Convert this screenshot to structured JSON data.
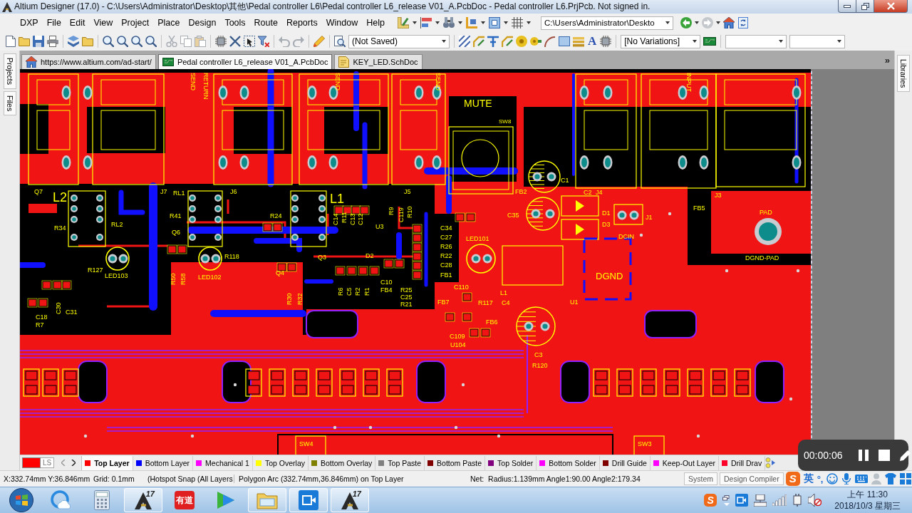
{
  "window": {
    "title": "Altium Designer (17.0) - C:\\Users\\Administrator\\Desktop\\其他\\Pedal controller L6\\Pedal controller L6_release V01_A.PcbDoc - Pedal controller L6.PrjPcb. Not signed in."
  },
  "menu": [
    "DXP",
    "File",
    "Edit",
    "View",
    "Project",
    "Place",
    "Design",
    "Tools",
    "Route",
    "Reports",
    "Window",
    "Help"
  ],
  "toolbar_1": {
    "path": "C:\\Users\\Administrator\\Deskto",
    "navigation": {
      "back": {
        "disabled": false
      },
      "forward": {
        "disabled": true
      }
    }
  },
  "toolbar_2": {
    "edit": {
      "cut": {
        "disabled": true
      },
      "copy": {
        "disabled": true
      },
      "paste": {
        "disabled": true
      },
      "undo": {
        "disabled": true
      },
      "redo": {
        "disabled": true
      }
    },
    "configuration": "(Not Saved)",
    "text_tool": "A",
    "variations": "[No Variations]"
  },
  "document_tabs": [
    {
      "kind": "home",
      "label": "https://www.altium.com/ad-start/",
      "selected": false
    },
    {
      "kind": "pcb",
      "label": "Pedal controller L6_release V01_A.PcbDoc",
      "selected": true
    },
    {
      "kind": "schematic",
      "label": "KEY_LED.SchDoc",
      "selected": false
    }
  ],
  "document_tabs_overflow": "»",
  "left_panel": [
    {
      "label": "Projects"
    },
    {
      "label": "Files"
    }
  ],
  "right_panel": [
    {
      "label": "Libraries"
    }
  ],
  "pcb": {
    "silkscreen": [
      "SEND",
      "RETURN",
      "SEND",
      "SEND",
      "INPUT",
      "MUTE",
      "SW8",
      "C1",
      "Q7",
      "L2",
      "J7",
      "RL1",
      "J6",
      "L1",
      "J5",
      "FB2",
      "C2",
      "J4",
      "J3",
      "R41",
      "R24",
      "C14",
      "R11",
      "C13",
      "C12",
      "R9",
      "C119",
      "R10",
      "C35",
      "D1",
      "J1",
      "FB5",
      "PAD",
      "R34",
      "RL2",
      "U3",
      "C34",
      "D3",
      "Q6",
      "C27",
      "LED101",
      "DCIN",
      "R26",
      "R118",
      "Q3",
      "D2",
      "R22",
      "DGND-PAD",
      "R127",
      "C28",
      "LED103",
      "R50",
      "R58",
      "LED102",
      "Q4",
      "FB1",
      "DGND",
      "C10",
      "C110",
      "R6",
      "C5",
      "R2",
      "R1",
      "FB4",
      "R25",
      "R30",
      "R32",
      "C25",
      "L1",
      "C30",
      "R21",
      "FB7",
      "R117",
      "C4",
      "U1",
      "C31",
      "C18",
      "FB6",
      "R7",
      "C109",
      "U104",
      "C3",
      "R120",
      "SW4",
      "SW3"
    ]
  },
  "layer_bar": {
    "current_layer": {
      "color": "#ff0000",
      "label": "LS"
    },
    "layers": [
      {
        "label": "Top Layer",
        "color": "#ff0000",
        "selected": true
      },
      {
        "label": "Bottom Layer",
        "color": "#0000ff",
        "selected": false
      },
      {
        "label": "Mechanical 1",
        "color": "#ff00ff",
        "selected": false
      },
      {
        "label": "Top Overlay",
        "color": "#ffff00",
        "selected": false
      },
      {
        "label": "Bottom Overlay",
        "color": "#808000",
        "selected": false
      },
      {
        "label": "Top Paste",
        "color": "#808080",
        "selected": false
      },
      {
        "label": "Bottom Paste",
        "color": "#800000",
        "selected": false
      },
      {
        "label": "Top Solder",
        "color": "#800080",
        "selected": false
      },
      {
        "label": "Bottom Solder",
        "color": "#ff00ff",
        "selected": false
      },
      {
        "label": "Drill Guide",
        "color": "#800000",
        "selected": false
      },
      {
        "label": "Keep-Out Layer",
        "color": "#ff00ff",
        "selected": false
      },
      {
        "label": "Drill Drav",
        "color": "#ff002a",
        "selected": false
      }
    ]
  },
  "recorder": {
    "time": "00:00:06"
  },
  "status_bar": {
    "cursor": "X:332.74mm Y:36.846mm",
    "grid": "Grid: 0.1mm",
    "snap": "(Hotspot Snap (All Layers",
    "selection": "Polygon Arc (332.74mm,36.846mm) on Top Layer",
    "net": "Net:  Radius:1.139mm Angle1:90.00 Angle2:179.34",
    "panels": [
      "System",
      "Design Compiler"
    ]
  },
  "ime_bar": {
    "logo": "S",
    "mode": "英",
    "punct": "°,",
    "tools": [
      {
        "kind": "smiley",
        "disabled": false
      },
      {
        "kind": "microphone",
        "disabled": false
      },
      {
        "kind": "keyboard",
        "disabled": false
      },
      {
        "kind": "user",
        "disabled": true
      },
      {
        "kind": "shirt",
        "disabled": false
      },
      {
        "kind": "apps",
        "disabled": false
      }
    ]
  },
  "taskbar": {
    "apps": [
      {
        "kind": "browser",
        "running": false
      },
      {
        "kind": "calculator",
        "running": false
      },
      {
        "kind": "altium",
        "badge": "17",
        "running": true
      },
      {
        "kind": "youdao",
        "text": "有道",
        "running": false
      },
      {
        "kind": "video_player",
        "running": false
      },
      {
        "kind": "explorer",
        "running": true
      },
      {
        "kind": "recorder",
        "running": true
      },
      {
        "kind": "altium",
        "badge": "17",
        "running": true
      }
    ],
    "tray": [
      {
        "kind": "sogou",
        "text": "S"
      },
      {
        "kind": "expand"
      },
      {
        "kind": "recorder"
      },
      {
        "kind": "network"
      },
      {
        "kind": "signal"
      },
      {
        "kind": "power"
      },
      {
        "kind": "volume",
        "muted": true
      }
    ],
    "clock": {
      "time": "上午 11:30",
      "date": "2018/10/3 星期三"
    }
  }
}
